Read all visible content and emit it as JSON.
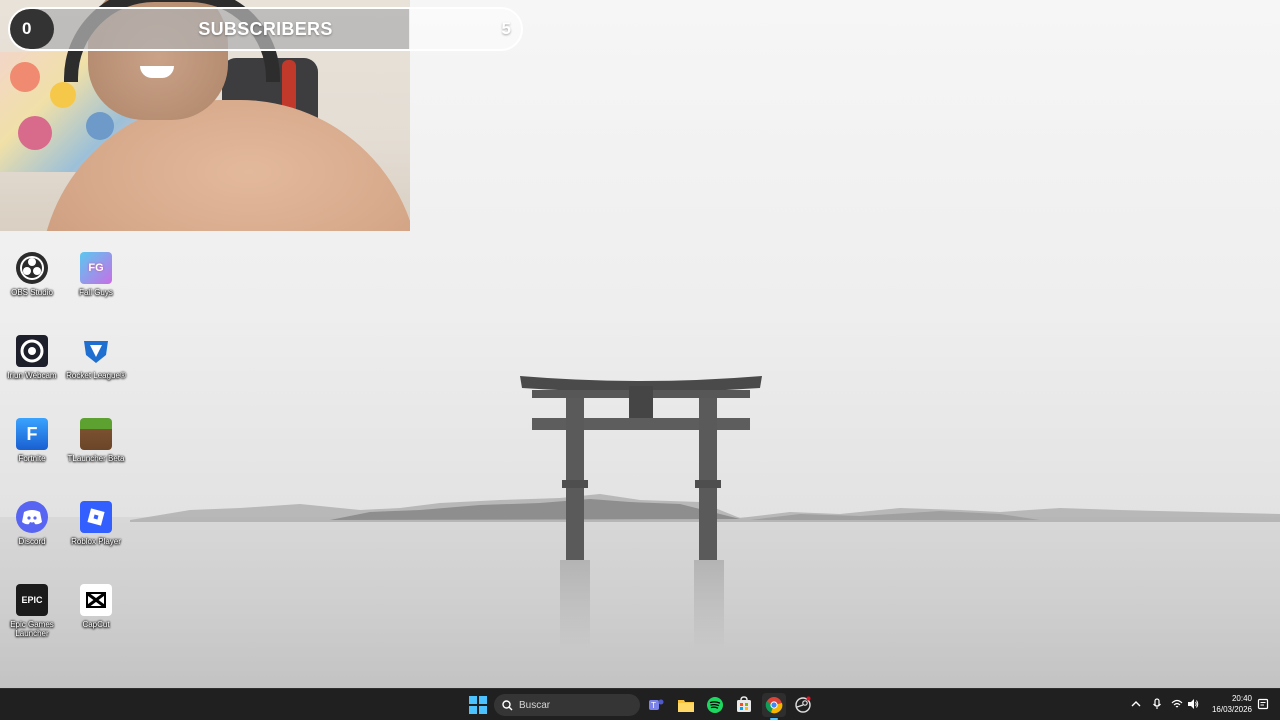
{
  "subscriber_widget": {
    "current": "0",
    "label": "SUBSCRIBERS",
    "goal": "5",
    "progress_fraction": 0.78
  },
  "desktop_icons": [
    {
      "label": "OBS Studio",
      "icon": "obs-icon"
    },
    {
      "label": "Fall Guys",
      "icon": "fall-guys-icon"
    },
    {
      "label": "Iriun Webcam",
      "icon": "iriun-webcam-icon"
    },
    {
      "label": "Rocket League®",
      "icon": "rocket-league-icon"
    },
    {
      "label": "Fortnite",
      "icon": "fortnite-icon"
    },
    {
      "label": "TLauncher Beta",
      "icon": "tlauncher-icon"
    },
    {
      "label": "Discord",
      "icon": "discord-icon"
    },
    {
      "label": "Roblox Player",
      "icon": "roblox-icon"
    },
    {
      "label": "Epic Games Launcher",
      "icon": "epic-games-icon"
    },
    {
      "label": "CapCut",
      "icon": "capcut-icon"
    }
  ],
  "taskbar": {
    "search_placeholder": "Buscar",
    "apps": [
      "windows-start-icon",
      "teams-icon",
      "file-explorer-icon",
      "spotify-icon",
      "store-icon",
      "chrome-icon",
      "steam-icon"
    ],
    "clock_time": "20:40",
    "clock_date": "16/03/2026"
  },
  "colors": {
    "taskbar_bg": "#202020",
    "sky": "#f2f2f2",
    "water": "#c9c9c9"
  }
}
